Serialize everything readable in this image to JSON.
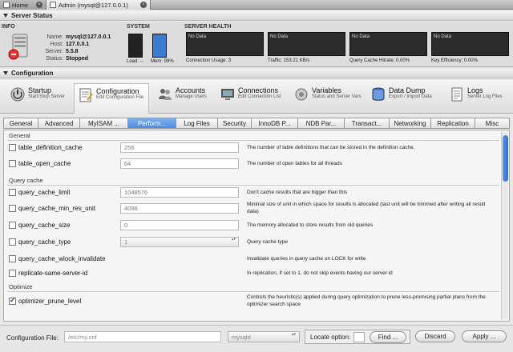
{
  "window_tabs": [
    {
      "label": "Home",
      "active": false
    },
    {
      "label": "Admin (mysql@127.0.0.1)",
      "active": true
    }
  ],
  "status": {
    "header": "Server Status",
    "info": {
      "title": "INFO",
      "rows": [
        {
          "key": "Name:",
          "value": "mysql@127.0.0.1"
        },
        {
          "key": "Host:",
          "value": "127.0.0.1"
        },
        {
          "key": "Server:",
          "value": "5.5.8"
        },
        {
          "key": "Status:",
          "value": "Stopped"
        }
      ]
    },
    "system": {
      "title": "SYSTEM",
      "load_label": "Load: --",
      "mem_label": "Mem: 99%",
      "load_pct": 0,
      "mem_pct": 99
    },
    "health": {
      "title": "SERVER HEALTH",
      "graphs": [
        {
          "placeholder": "No Data",
          "label": "Connection Usage: 3"
        },
        {
          "placeholder": "No Data",
          "label": "Traffic: 153.21 KB/s"
        },
        {
          "placeholder": "No Data",
          "label": "Query Cache Hitrate: 0.00%"
        },
        {
          "placeholder": "No Data",
          "label": "Key Efficiency: 0.00%"
        }
      ]
    }
  },
  "configuration": {
    "header": "Configuration",
    "tools": [
      {
        "name": "Startup",
        "sub": "Start/Stop Server",
        "icon": "startup-icon"
      },
      {
        "name": "Configuration",
        "sub": "Edit Configuration File",
        "icon": "configuration-icon",
        "active": true
      },
      {
        "name": "Accounts",
        "sub": "Manage Users",
        "icon": "accounts-icon"
      },
      {
        "name": "Connections",
        "sub": "Edit Connection List",
        "icon": "connections-icon"
      },
      {
        "name": "Variables",
        "sub": "Status and Server Vars",
        "icon": "variables-icon"
      },
      {
        "name": "Data Dump",
        "sub": "Export / Import Data",
        "icon": "data-dump-icon"
      },
      {
        "name": "Logs",
        "sub": "Server Log Files",
        "icon": "logs-icon"
      }
    ],
    "tabs": [
      "General",
      "Advanced",
      "MyISAM ...",
      "Perform...",
      "Log Files",
      "Security",
      "InnoDB P...",
      "NDB Par...",
      "Transact...",
      "Networking",
      "Replication",
      "Misc"
    ],
    "active_tab": "Perform..."
  },
  "groups": {
    "general": "General",
    "query_cache": "Query cache",
    "optimize": "Optimize"
  },
  "options": {
    "table_definition_cache": {
      "name": "table_definition_cache",
      "value": "256",
      "desc": "The number of table definitions that can be stored in the definition cache.",
      "checked": false
    },
    "table_open_cache": {
      "name": "table_open_cache",
      "value": "64",
      "desc": "The number of open tables for all threads",
      "checked": false
    },
    "query_cache_limit": {
      "name": "query_cache_limit",
      "value": "1048576",
      "desc": "Don't cache results that are bigger than this",
      "checked": false
    },
    "query_cache_min_res_unit": {
      "name": "query_cache_min_res_unit",
      "value": "4096",
      "desc": "Minimal size of unit in which space for results is allocated (last unit will be trimmed after writing all result data)",
      "checked": false
    },
    "query_cache_size": {
      "name": "query_cache_size",
      "value": "0",
      "desc": "The memory allocated to store results from old queries",
      "checked": false
    },
    "query_cache_type": {
      "name": "query_cache_type",
      "value": "1",
      "desc": "Query cache type",
      "checked": false
    },
    "query_cache_wlock_invalidate": {
      "name": "query_cache_wlock_invalidate",
      "desc": "Invalidate queries in query cache on LOCK for write",
      "checked": false
    },
    "replicate_same_server_id": {
      "name": "replicate-same-server-id",
      "desc": "In replication, if set to 1, do not skip events having our server id",
      "checked": false
    },
    "optimizer_prune_level": {
      "name": "optimizer_prune_level",
      "desc": "Controls the heuristic(s) applied during query optimization to prune less-promising partial plans from the optimizer search space",
      "checked": true
    }
  },
  "bottom": {
    "config_file_label": "Configuration File:",
    "config_file_path": "/etc/my.cnf",
    "section": "mysqld",
    "locate_label": "Locate option:",
    "find_label": "Find ...",
    "discard_label": "Discard",
    "apply_label": "Apply ..."
  }
}
